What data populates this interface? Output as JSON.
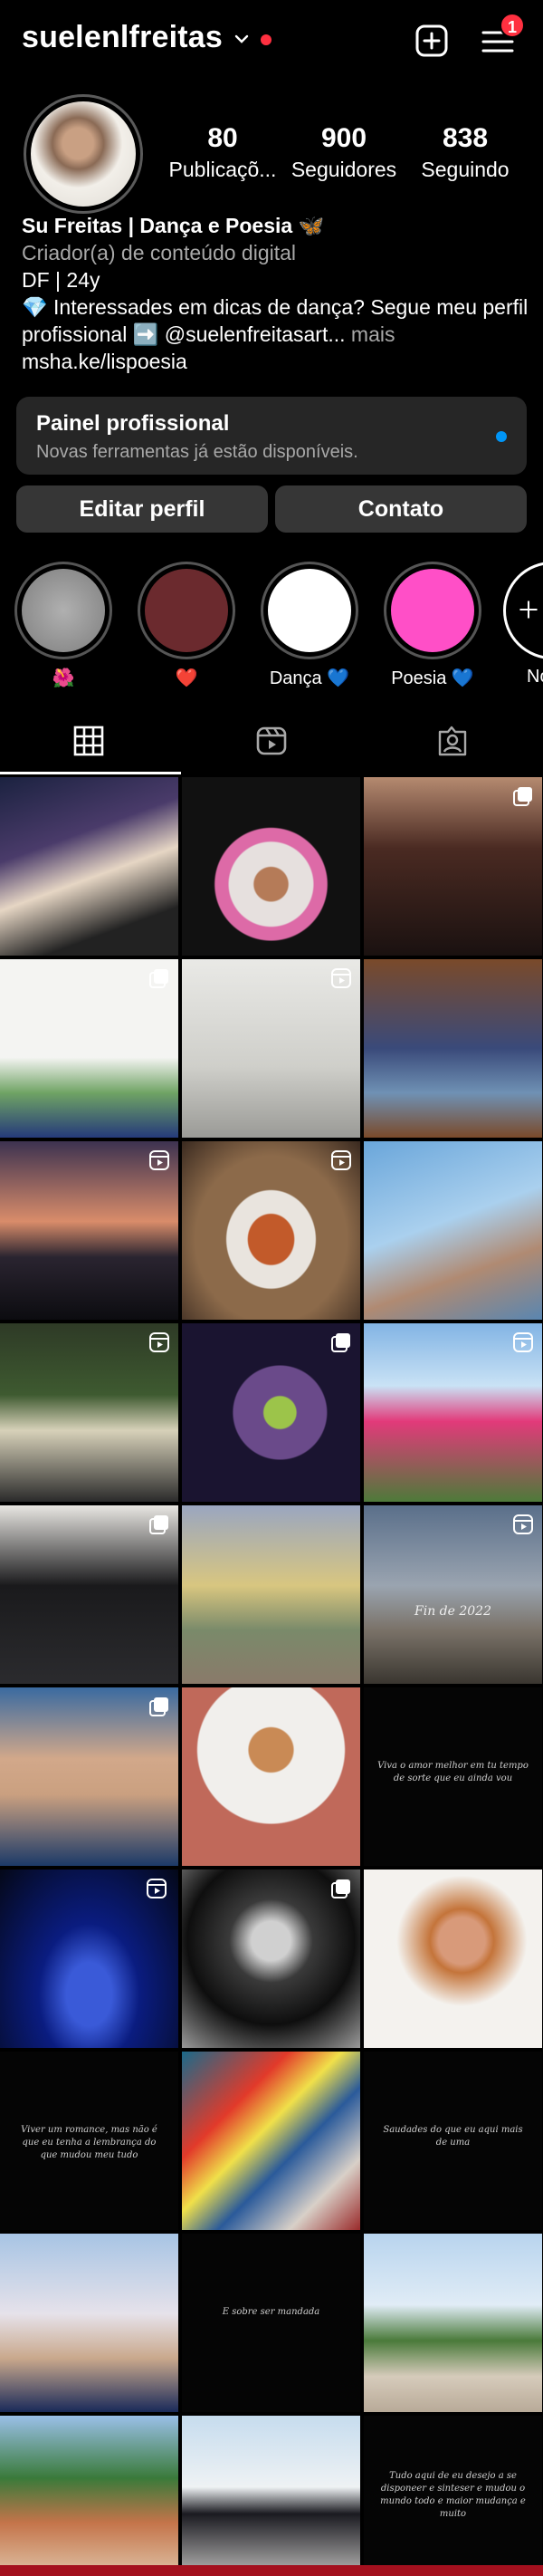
{
  "header": {
    "username": "suelenlfreitas",
    "menu_badge": "1"
  },
  "profile": {
    "stats": [
      {
        "value": "80",
        "label": "Publicaçõ..."
      },
      {
        "value": "900",
        "label": "Seguidores"
      },
      {
        "value": "838",
        "label": "Seguindo"
      }
    ],
    "name": "Su Freitas | Dança e Poesia 🦋",
    "category": "Criador(a) de conteúdo digital",
    "bio_line1": "DF | 24y",
    "bio_line2": "💎 Interessades em dicas de dança? Segue meu perfil profissional ➡️ @suelenfreitasart...",
    "bio_more": " mais",
    "link": "msha.ke/lispoesia"
  },
  "panel": {
    "title": "Painel profissional",
    "subtitle": "Novas ferramentas já estão disponíveis."
  },
  "buttons": {
    "edit": "Editar perfil",
    "contact": "Contato"
  },
  "highlights": [
    {
      "label": "🌺",
      "color": "#9a9a9a"
    },
    {
      "label": "❤️",
      "color": "#6b2a2e"
    },
    {
      "label": "Dança 💙",
      "color": "#ffffff"
    },
    {
      "label": "Poesia 💙",
      "color": "#ff4fc7"
    },
    {
      "label": "No",
      "color": "#000000"
    }
  ],
  "tabs": [
    "grid-icon",
    "reels-icon",
    "tagged-icon"
  ],
  "grid_texts": {
    "t17": "Viva o amor melhor em tu tempo de sorte que eu ainda vou",
    "t21": "Viver um romance, mas não é que eu tenha a lembrança do que mudou meu tudo",
    "t23": "Saudades do que eu aqui mais de uma",
    "t25": "E sobre ser mandada",
    "t29": "Tudo aqui de eu desejo a se disponeer e sinteser e mudou o mundo todo e maior mudança e muito"
  },
  "grid_overlay_text": "Fin de 2022",
  "colors": {
    "accent": "#0095f6",
    "badge": "#ff3040",
    "panel_bg": "#262626",
    "button_bg": "#363636"
  }
}
